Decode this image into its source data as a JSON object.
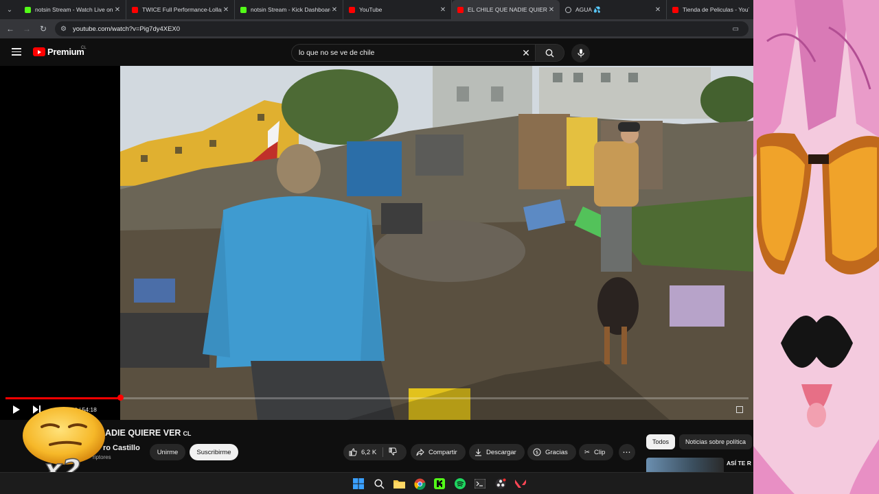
{
  "browser": {
    "tabs": [
      {
        "title": "notsin Stream - Watch Live on",
        "icon": "kick-icon",
        "active": false
      },
      {
        "title": "TWICE Full Performance-Lollap",
        "icon": "youtube-icon",
        "active": false
      },
      {
        "title": "notsin Stream - Kick Dashboard",
        "icon": "kick-icon",
        "active": false
      },
      {
        "title": "YouTube",
        "icon": "youtube-icon",
        "active": false
      },
      {
        "title": "EL CHILE QUE NADIE QUIERE V",
        "icon": "youtube-icon",
        "active": true
      },
      {
        "title": "AGUA 💦",
        "icon": "globe-icon",
        "active": false
      },
      {
        "title": "Tienda de Peliculas - YouTub",
        "icon": "youtube-icon",
        "active": false
      }
    ],
    "url": "youtube.com/watch?v=Pig7dy4XEX0"
  },
  "youtube": {
    "logo_text": "Premium",
    "country_code": "CL",
    "search_query": "lo que no se ve de chile"
  },
  "player": {
    "time_display": "14 / 54:18",
    "progress_fraction": 0.155
  },
  "video": {
    "title_visible": "ADIE QUIERE VER",
    "title_suffix": "CL",
    "channel_name": "ro Castillo",
    "subscribers": "riptores",
    "join_label": "Unirme",
    "subscribe_label": "Suscribirme",
    "likes": "6,2 K",
    "share_label": "Compartir",
    "download_label": "Descargar",
    "thanks_label": "Gracias",
    "clip_label": "Clip"
  },
  "sidebar": {
    "chips": [
      "Todos",
      "Noticias sobre política"
    ],
    "selected_chip": "Todos",
    "rec_title": "ASÍ TE R"
  },
  "overlay": {
    "multiplier": "x2"
  },
  "colors": {
    "accent": "#ff0000",
    "background": "#0f0f0f",
    "overlay_pink": "#f3c9de"
  }
}
